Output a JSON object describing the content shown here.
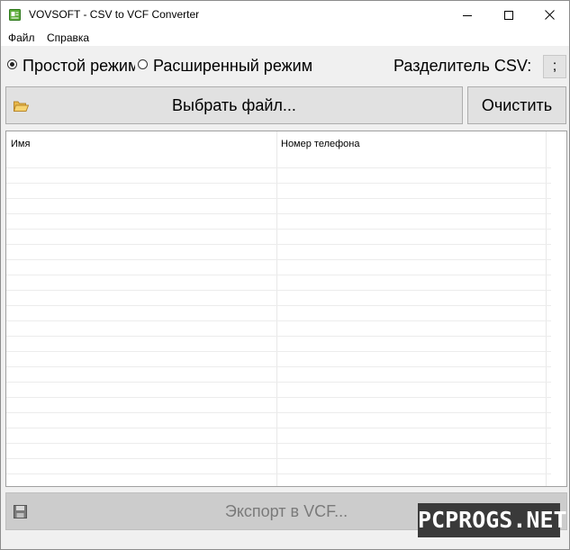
{
  "window": {
    "title": "VOVSOFT - CSV to VCF Converter"
  },
  "menu": {
    "file": "Файл",
    "help": "Справка"
  },
  "options": {
    "simple_mode": "Простой режим",
    "advanced_mode": "Расширенный режим",
    "simple_selected": true,
    "separator_label": "Разделитель CSV:",
    "separator_value": ";"
  },
  "buttons": {
    "choose_file": "Выбрать файл...",
    "clear": "Очистить",
    "export": "Экспорт в VCF..."
  },
  "grid": {
    "columns": [
      "Имя",
      "Номер телефона"
    ],
    "rows": []
  },
  "watermark": "PCPROGS.NET",
  "icons": {
    "app": "vcard-icon",
    "folder": "folder-open-icon",
    "save": "floppy-disk-icon"
  },
  "colors": {
    "window_bg": "#f0f0f0",
    "button_bg": "#e1e1e1",
    "export_disabled_bg": "#cccccc",
    "export_disabled_text": "#7a7a7a",
    "watermark_bg": "#3a3a3a"
  }
}
